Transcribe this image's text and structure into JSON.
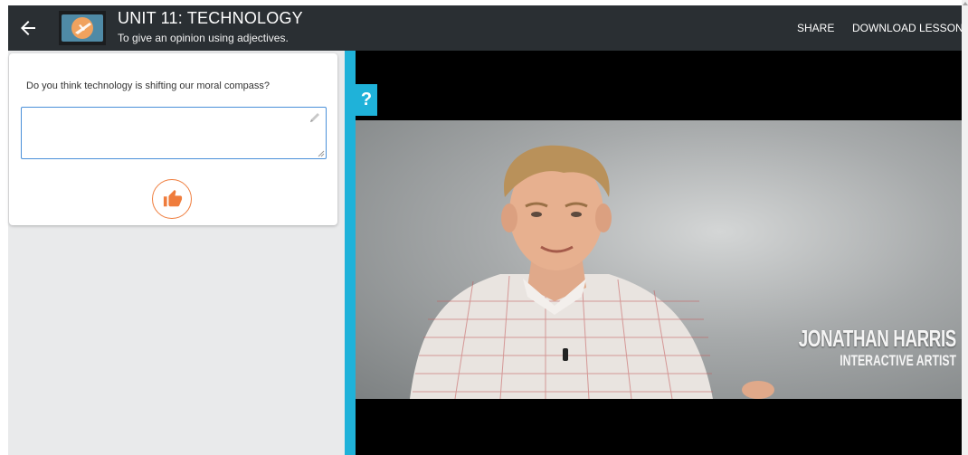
{
  "header": {
    "title": "UNIT 11: TECHNOLOGY",
    "subtitle": "To give an opinion using adjectives.",
    "share_label": "SHARE",
    "download_label": "DOWNLOAD LESSON",
    "back_icon": "arrow-left-icon",
    "thumbnail_icon": "airplane-icon",
    "background_color": "#2a2f33"
  },
  "question_card": {
    "question": "Do you think technology is shifting our moral compass?",
    "answer_value": "",
    "answer_placeholder": "",
    "edit_icon": "pencil-icon",
    "submit_icon": "thumbs-up-icon",
    "accent_color": "#ef7c3c"
  },
  "video": {
    "help_label": "?",
    "speaker_name": "JONATHAN HARRIS",
    "speaker_role": "INTERACTIVE ARTIST",
    "divider_color": "#1fb2d9"
  }
}
